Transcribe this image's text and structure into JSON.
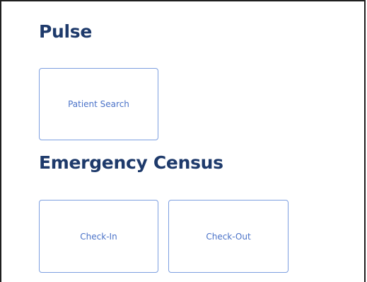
{
  "sections": [
    {
      "title": "Pulse",
      "tiles": [
        {
          "label": "Patient Search"
        }
      ]
    },
    {
      "title": "Emergency Census",
      "tiles": [
        {
          "label": "Check-In"
        },
        {
          "label": "Check-Out"
        }
      ]
    }
  ],
  "colors": {
    "heading": "#1e3a6b",
    "tile_border": "#7d9fe0",
    "tile_text": "#4a72c8",
    "frame_border": "#1f1f1f"
  }
}
